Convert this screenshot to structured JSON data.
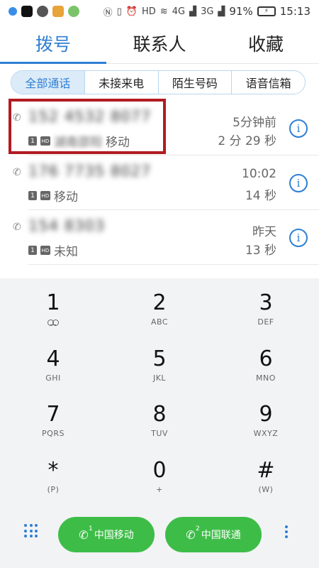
{
  "statusbar": {
    "battery": "91%",
    "time": "15:13",
    "net1": "4G",
    "net2": "3G"
  },
  "tabs": [
    {
      "label": "拨号",
      "active": true
    },
    {
      "label": "联系人",
      "active": false
    },
    {
      "label": "收藏",
      "active": false
    }
  ],
  "filters": [
    {
      "label": "全部通话",
      "active": true
    },
    {
      "label": "未接来电",
      "active": false
    },
    {
      "label": "陌生号码",
      "active": false
    },
    {
      "label": "语音信箱",
      "active": false
    }
  ],
  "calls": [
    {
      "number": "152 4532 8077",
      "location": "湖南邵阳",
      "carrier": "移动",
      "time": "5分钟前",
      "duration": "2 分 29 秒"
    },
    {
      "number": "176 7735 8027",
      "location": "",
      "carrier": "移动",
      "time": "10:02",
      "duration": "14 秒"
    },
    {
      "number": "154 8303",
      "location": "",
      "carrier": "未知",
      "time": "昨天",
      "duration": "13 秒"
    }
  ],
  "keypad": [
    {
      "digit": "1",
      "letters": ""
    },
    {
      "digit": "2",
      "letters": "ABC"
    },
    {
      "digit": "3",
      "letters": "DEF"
    },
    {
      "digit": "4",
      "letters": "GHI"
    },
    {
      "digit": "5",
      "letters": "JKL"
    },
    {
      "digit": "6",
      "letters": "MNO"
    },
    {
      "digit": "7",
      "letters": "PQRS"
    },
    {
      "digit": "8",
      "letters": "TUV"
    },
    {
      "digit": "9",
      "letters": "WXYZ"
    },
    {
      "digit": "*",
      "letters": "(P)"
    },
    {
      "digit": "0",
      "letters": "+"
    },
    {
      "digit": "#",
      "letters": "(W)"
    }
  ],
  "bottom": {
    "sim1_label": "中国移动",
    "sim2_label": "中国联通",
    "sim1_index": "1",
    "sim2_index": "2",
    "hd": "HD"
  },
  "colors": {
    "accent": "#2e7fd3",
    "call_green": "#3dbd47",
    "highlight": "#b21b22"
  }
}
